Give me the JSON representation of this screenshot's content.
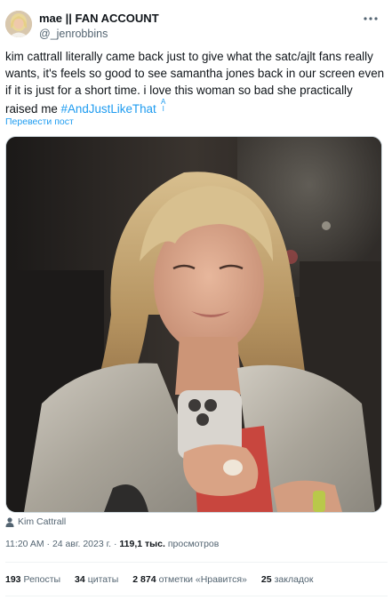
{
  "user": {
    "display_name": "mae || FAN ACCOUNT",
    "handle": "@_jenrobbins",
    "avatar_icon": "avatar-photo"
  },
  "tweet": {
    "text": "kim cattrall literally came back just to give what the satc/ajlt fans really wants, it's feels so good to see samantha jones back in our screen even if it is just for a short time. i love this woman so bad she practically raised me ",
    "hashtag": "#AndJustLikeThat",
    "translate_label": "Перевести пост"
  },
  "media": {
    "tagged_person": "Kim Cattrall",
    "person_icon": "person-icon"
  },
  "meta": {
    "time": "11:20 AM",
    "separator": " · ",
    "date": "24 авг. 2023 г.",
    "views_count": "119,1 тыс.",
    "views_label": " просмотров"
  },
  "stats": {
    "reposts_count": "193",
    "reposts_label": "Репосты",
    "quotes_count": "34",
    "quotes_label": "цитаты",
    "likes_count": "2 874",
    "likes_label": "отметки «Нравится»",
    "bookmarks_count": "25",
    "bookmarks_label": "закладок"
  },
  "colors": {
    "link": "#1d9bf0",
    "secondary_text": "#536471",
    "primary_text": "#0f1419",
    "divider": "#eff3f4"
  }
}
